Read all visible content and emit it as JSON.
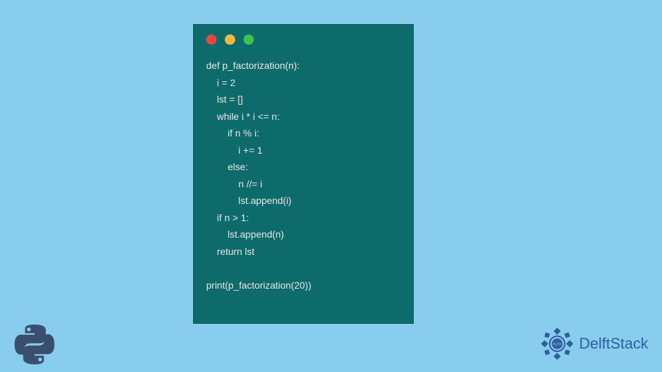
{
  "code": {
    "lines": [
      "def p_factorization(n):",
      "    i = 2",
      "    lst = []",
      "    while i * i <= n:",
      "        if n % i:",
      "            i += 1",
      "        else:",
      "            n //= i",
      "            lst.append(i)",
      "    if n > 1:",
      "        lst.append(n)",
      "    return lst",
      "",
      "print(p_factorization(20))"
    ]
  },
  "branding": {
    "name": "DelftStack"
  },
  "colors": {
    "background": "#88cdee",
    "window": "#0e6b6b",
    "brand": "#2f5d9e"
  }
}
